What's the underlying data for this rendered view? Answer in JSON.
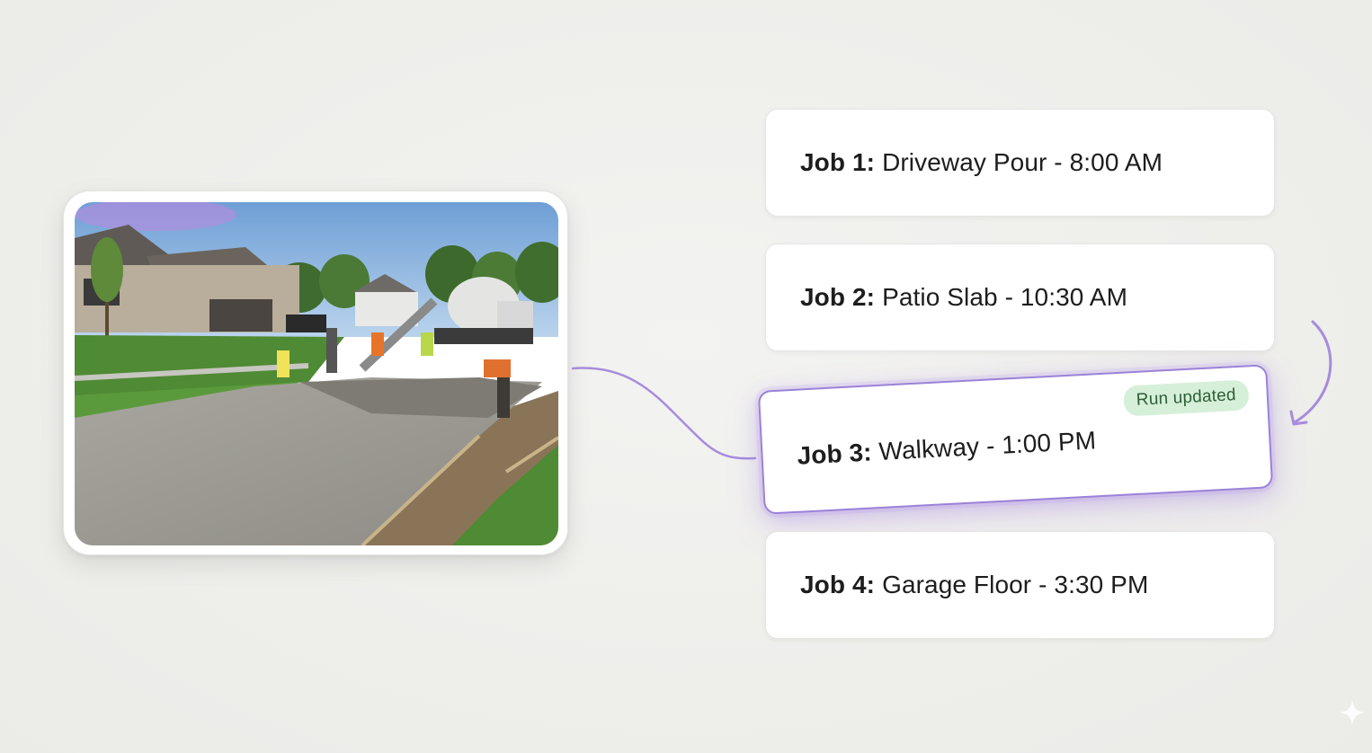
{
  "jobs": [
    {
      "num": "Job 1:",
      "desc": "Driveway Pour - 8:00 AM"
    },
    {
      "num": "Job 2:",
      "desc": "Patio Slab - 10:30 AM"
    },
    {
      "num": "Job 3:",
      "desc": "Walkway - 1:00 PM",
      "badge": "Run updated"
    },
    {
      "num": "Job 4:",
      "desc": "Garage Floor - 3:30 PM"
    }
  ],
  "colors": {
    "accent": "#9b82d8",
    "badge_bg": "#d6efd9",
    "badge_text": "#2d5e36",
    "background": "#efefec"
  },
  "icons": {
    "connector": "curved-connector-line",
    "reorder_arrow": "curved-arrow-icon",
    "watermark": "sparkle-icon"
  },
  "photo": {
    "subject": "concrete-driveway-pour-scene"
  }
}
